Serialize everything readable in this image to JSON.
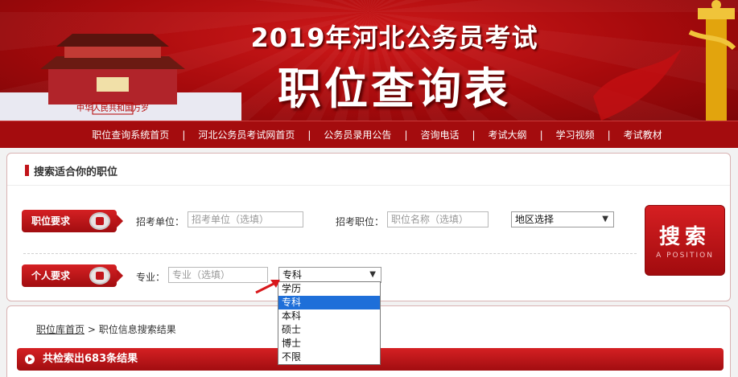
{
  "banner": {
    "title_line1": "2019年河北公务员考试",
    "title_line2": "职位查询表",
    "gate_sign": "中华人民共和国万岁"
  },
  "nav": {
    "items": [
      "职位查询系统首页",
      "河北公务员考试网首页",
      "公务员录用公告",
      "咨询电话",
      "考试大纲",
      "学习视频",
      "考试教材"
    ],
    "separator": "|"
  },
  "search_panel": {
    "heading": "搜索适合你的职位",
    "job_req_label": "职位要求",
    "unit_label": "招考单位：",
    "unit_placeholder": "招考单位（选填）",
    "position_label": "招考职位：",
    "position_placeholder": "职位名称（选填）",
    "region_select": "地区选择",
    "personal_req_label": "个人要求",
    "major_label": "专业：",
    "major_placeholder": "专业（选填）",
    "education_select": "专科",
    "search_button": "搜索",
    "search_button_sub": "A POSITION"
  },
  "education_dropdown": {
    "options": [
      "学历",
      "专科",
      "本科",
      "硕士",
      "博士",
      "不限"
    ],
    "selected_index": 1
  },
  "results": {
    "crumb_home": "职位库首页",
    "crumb_sep": ">",
    "crumb_current": "职位信息搜索结果",
    "result_text": "共检索出683条结果"
  },
  "colors": {
    "brand_red": "#c1141a",
    "dark_red": "#a10d10",
    "select_blue": "#1e6fd9"
  }
}
